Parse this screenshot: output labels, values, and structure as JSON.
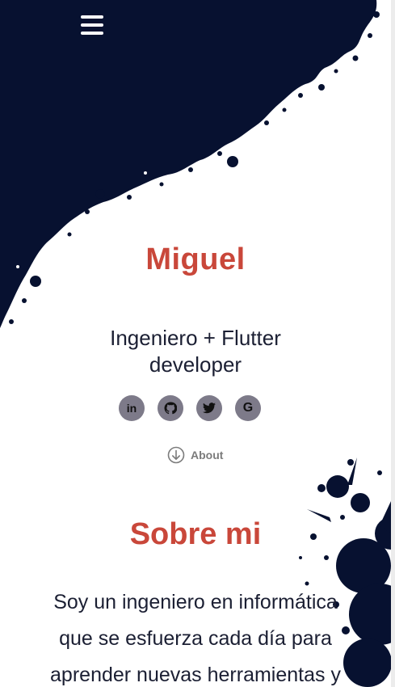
{
  "colors": {
    "accent": "#c9473a",
    "ink": "#071130",
    "icon_bg": "#7d7a89",
    "text": "#1b1f33"
  },
  "nav": {
    "menu_icon": "hamburger-menu-icon"
  },
  "hero": {
    "name": "Miguel",
    "subtitle_line1": "Ingeniero + Flutter",
    "subtitle_line2": "developer"
  },
  "socials": [
    {
      "label": "in",
      "icon": "linkedin-icon"
    },
    {
      "label": "",
      "icon": "github-icon"
    },
    {
      "label": "",
      "icon": "twitter-icon"
    },
    {
      "label": "G",
      "icon": "google-icon"
    }
  ],
  "about_link": {
    "label": "About",
    "icon": "arrow-down-circle-icon"
  },
  "about": {
    "title": "Sobre mi",
    "lines": [
      "Soy un ingeniero en informática",
      "que se esfuerza cada día para",
      "aprender nuevas herramientas y"
    ]
  }
}
